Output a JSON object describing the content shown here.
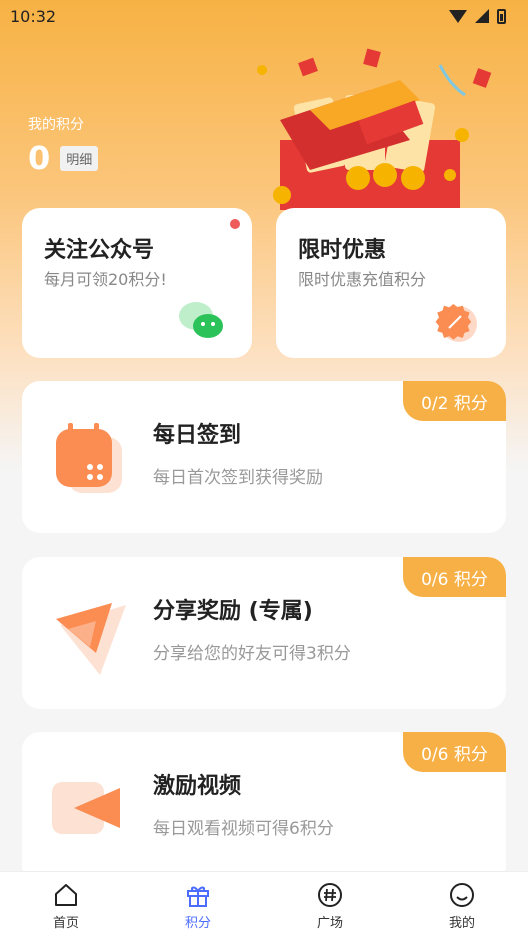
{
  "status": {
    "time": "10:32"
  },
  "header": {
    "points_label": "我的积分",
    "points_value": "0",
    "detail_label": "明细"
  },
  "promo_cards": [
    {
      "title": "关注公众号",
      "subtitle": "每月可领20积分!"
    },
    {
      "title": "限时优惠",
      "subtitle": "限时优惠充值积分"
    }
  ],
  "tasks": [
    {
      "title": "每日签到",
      "subtitle": "每日首次签到获得奖励",
      "badge": "0/2 积分"
    },
    {
      "title": "分享奖励 (专属)",
      "subtitle": "分享给您的好友可得3积分",
      "badge": "0/6 积分"
    },
    {
      "title": "激励视频",
      "subtitle": "每日观看视频可得6积分",
      "badge": "0/6 积分"
    }
  ],
  "tabbar": [
    {
      "label": "首页",
      "icon": "home-icon"
    },
    {
      "label": "积分",
      "icon": "gift-icon"
    },
    {
      "label": "广场",
      "icon": "hashtag-icon"
    },
    {
      "label": "我的",
      "icon": "smiley-icon"
    }
  ],
  "colors": {
    "accent": "#f7b046",
    "tab_active": "#4b6cff",
    "red_dot": "#ef5a5a"
  }
}
